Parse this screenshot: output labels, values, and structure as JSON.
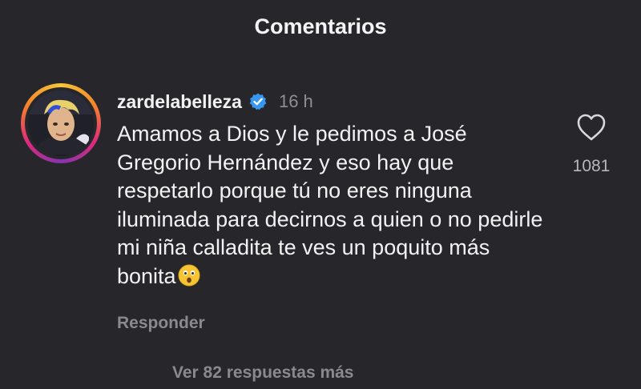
{
  "header": {
    "title": "Comentarios"
  },
  "comment": {
    "username": "zardelabelleza",
    "verified": true,
    "time": "16 h",
    "text": "Amamos a Dios y le pedimos a José Gregorio Hernández y eso hay que respetarlo porque tú no eres ninguna iluminada para decirnos a quien o no pedirle mi niña calladita te ves un poquito más bonita",
    "emoji": "astonished-face",
    "reply_label": "Responder",
    "like_count": "1081",
    "more_replies": "Ver 82 respuestas más"
  },
  "colors": {
    "background": "#27272b",
    "text": "#f2f2f2",
    "muted": "#8a8a8e",
    "verified_badge": "#3897f0"
  }
}
